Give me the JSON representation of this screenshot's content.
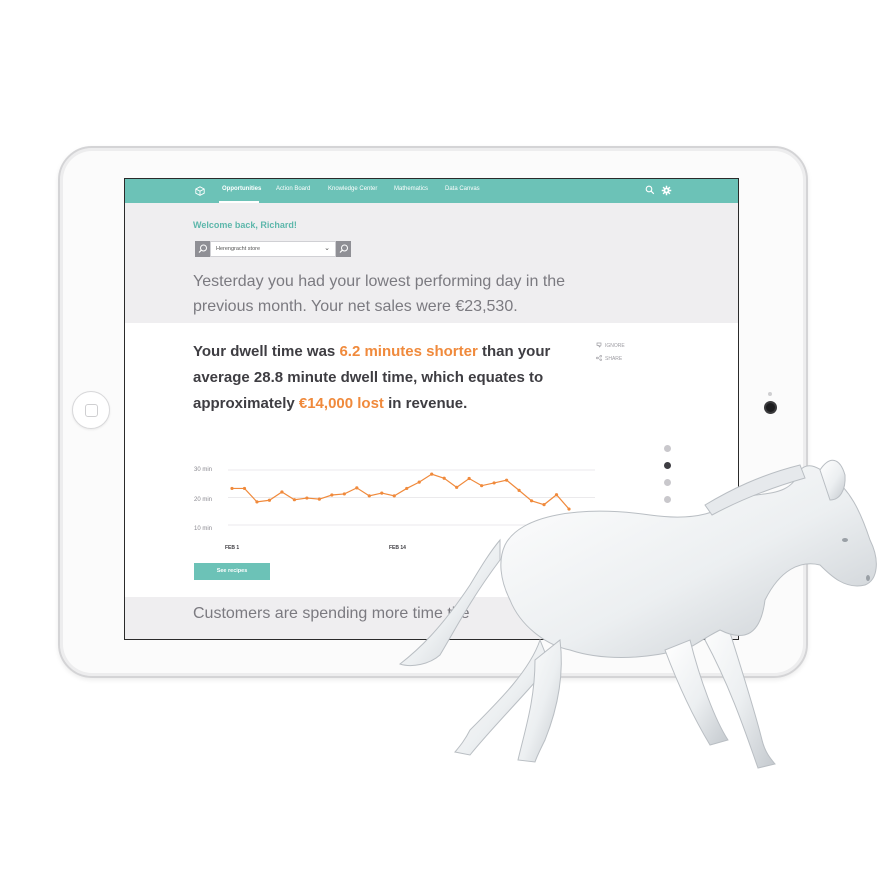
{
  "nav": {
    "items": [
      {
        "label": "Opportunities",
        "active": true
      },
      {
        "label": "Action Board",
        "active": false
      },
      {
        "label": "Knowledge Center",
        "active": false
      },
      {
        "label": "Mathematics",
        "active": false
      },
      {
        "label": "Data Canvas",
        "active": false
      }
    ],
    "icons": [
      "cube-logo-icon",
      "search-icon",
      "gear-icon"
    ]
  },
  "hero": {
    "welcome": "Welcome back, Richard!",
    "store": {
      "selected": "Herengracht store"
    },
    "summary": "Yesterday you had your lowest performing day in the previous month. Your net sales were €23,530."
  },
  "insight": {
    "part1": "Your dwell time was ",
    "highlight1": "6.2 minutes shorter",
    "part2": " than your average 28.8 minute dwell time, which equates to approximately ",
    "highlight2": "€14,000 lost",
    "part3": " in revenue."
  },
  "actions": {
    "ignore": "IGNORE",
    "share": "SHARE"
  },
  "pager": {
    "count": 4,
    "active_index": 1
  },
  "chart_data": {
    "type": "line",
    "y_ticks": [
      "30 min",
      "20 min",
      "10 min"
    ],
    "ylim": [
      10,
      30
    ],
    "x_tick_labels": [
      "FEB 1",
      "FEB 14"
    ],
    "grid": true,
    "series": [
      {
        "color": "#f08a3c",
        "x": [
          "FEB 1",
          "FEB 2",
          "FEB 3",
          "FEB 4",
          "FEB 5",
          "FEB 6",
          "FEB 7",
          "FEB 8",
          "FEB 9",
          "FEB 10",
          "FEB 11",
          "FEB 12",
          "FEB 13",
          "FEB 14",
          "FEB 15",
          "FEB 16",
          "FEB 17",
          "FEB 18",
          "FEB 19",
          "FEB 20",
          "FEB 21",
          "FEB 22",
          "FEB 23",
          "FEB 24",
          "FEB 25",
          "FEB 26",
          "FEB 27",
          "FEB 28"
        ],
        "values": [
          23.3,
          23.3,
          18.4,
          19.0,
          22.0,
          19.2,
          19.8,
          19.4,
          20.9,
          21.3,
          23.5,
          20.6,
          21.6,
          20.6,
          23.3,
          25.6,
          28.5,
          27.0,
          23.7,
          26.9,
          24.3,
          25.3,
          26.3,
          22.6,
          18.8,
          17.4,
          21.0,
          15.8
        ]
      }
    ]
  },
  "cta": {
    "label": "See recipes"
  },
  "next_card": {
    "text": "Customers are spending more time the"
  },
  "colors": {
    "accent": "#6cc2b7",
    "highlight": "#f08a3c",
    "text_dark": "#3e3d42",
    "text_muted": "#7b7a80",
    "hero_bg": "#efeef0"
  }
}
